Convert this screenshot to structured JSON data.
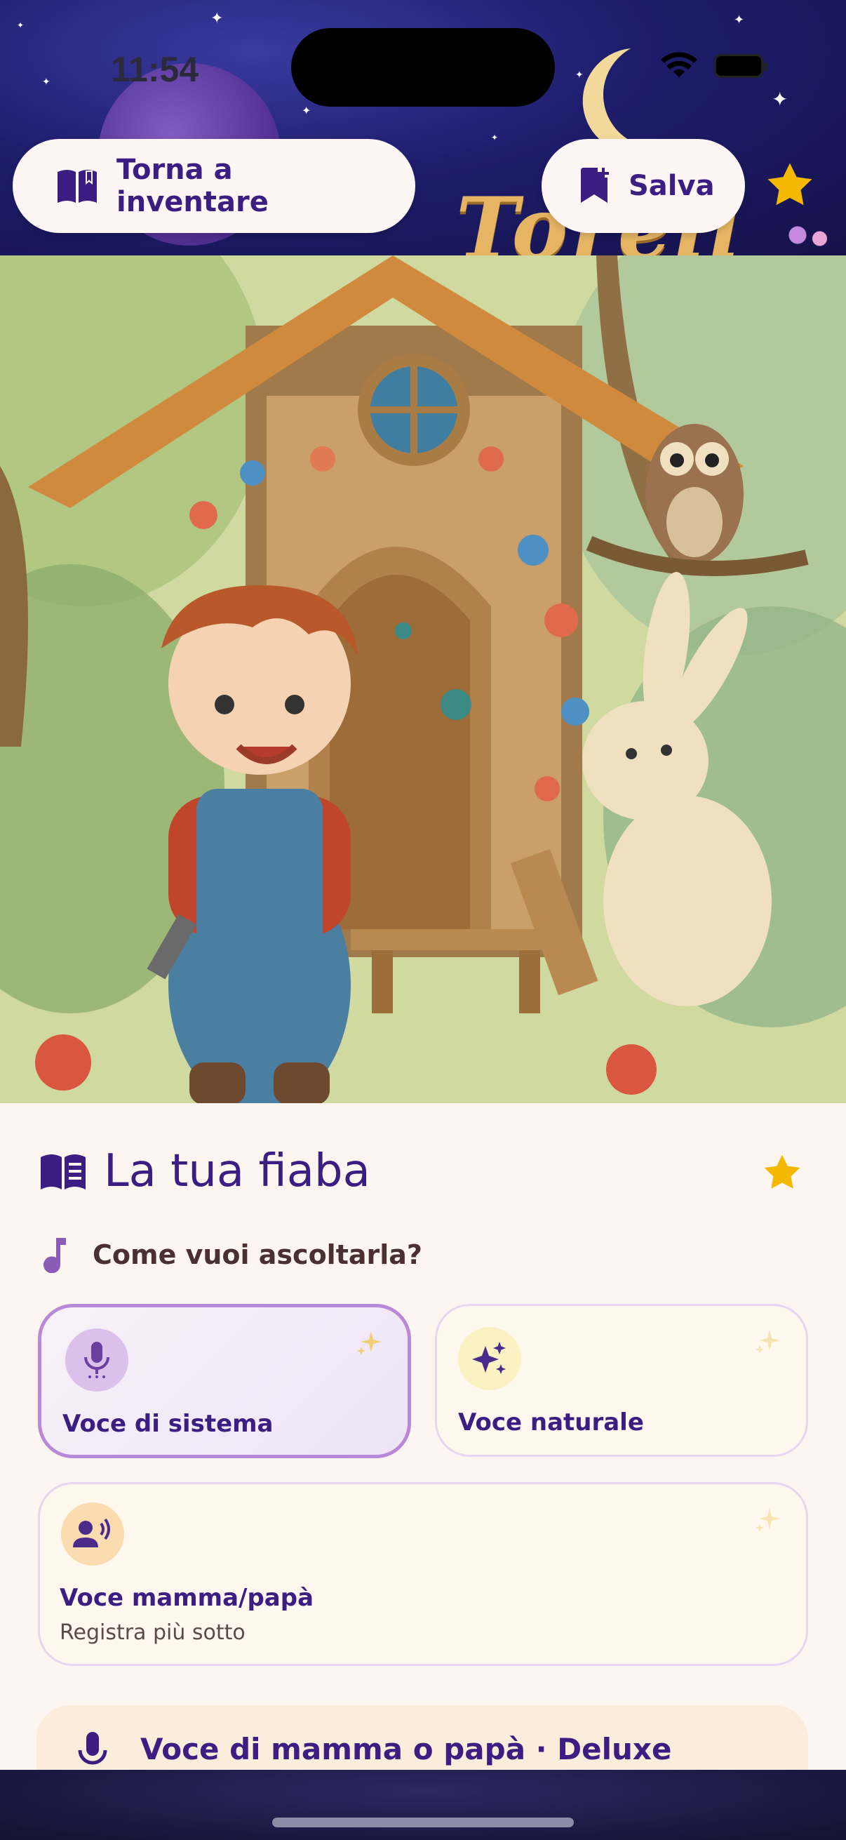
{
  "status_bar": {
    "time": "11:54"
  },
  "header": {
    "back_label": "Torna a inventare",
    "save_label": "Salva",
    "logo_text": "Torell"
  },
  "story": {
    "title": "La tua fiaba",
    "question": "Come vuoi ascoltarla?",
    "voices": [
      {
        "label": "Voce di sistema",
        "selected": true,
        "icon": "microphone-icon"
      },
      {
        "label": "Voce naturale",
        "selected": false,
        "icon": "sparkles-icon"
      },
      {
        "label": "Voce mamma/papà",
        "sublabel": "Registra più sotto",
        "selected": false,
        "icon": "speaking-person-icon"
      }
    ],
    "deluxe_label": "Voce di mamma o papà · Deluxe"
  },
  "colors": {
    "brand_purple": "#3c1d82",
    "star_gold": "#f5b800",
    "selected_border": "#b889d6"
  }
}
